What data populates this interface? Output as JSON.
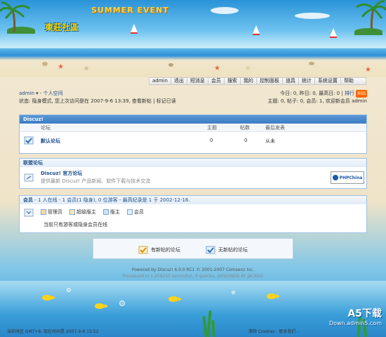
{
  "header": {
    "banner_title": "SUMMER EVENT",
    "logo_text": "東莊社區"
  },
  "nav": {
    "items": [
      "admin",
      "退出",
      "短消息",
      "会员",
      "搜索",
      "我的",
      "控制面板",
      "道具",
      "统计",
      "系统设置",
      "帮助"
    ]
  },
  "userbar": {
    "user": "admin",
    "space_link": "- 个人空间",
    "status_line": "状态: 隐身模式, 您上次访问是在 2007-9-6 13:39, 查看新帖 | 标记已读",
    "stats_line": "今日: 0, 昨日: 0, 最高日: 0 |",
    "stats_link": "排行",
    "rss": "RSS",
    "summary_line": "主题: 0, 帖子: 0, 会员: 1, 欢迎新会员 admin"
  },
  "forum_panel": {
    "title": "Discuz!",
    "columns": [
      "论坛",
      "主题",
      "帖数",
      "最后发表"
    ],
    "rows": [
      {
        "name": "默认论坛",
        "topics": "0",
        "posts": "0",
        "last": "从未"
      }
    ]
  },
  "union_panel": {
    "title": "联盟论坛",
    "name": "Discuz! 官方论坛",
    "desc": "提供最新 Discuz! 产品新闻、软件下载与技术交流",
    "logo": "PHPChina"
  },
  "online_panel": {
    "title": "会员",
    "summary": " - 1 人在线 - 1 会员(1 隐身), 0 位游客 - 最高纪录是 1 于 2002-12-16.",
    "roles": [
      "管理员",
      "超级版主",
      "版主",
      "会员"
    ],
    "note": "当前只有游客或隐身会员在线"
  },
  "legend": {
    "new_posts": "有新帖的论坛",
    "no_new_posts": "无新帖的论坛"
  },
  "footer": {
    "line1": "Powered by Discuz! 6.0.0 RC1 © 2001-2007 Comsenz Inc.",
    "line2": "Processed in 1.209255 second(s), 4 queries. DESIGNED BY JACKOO",
    "time_line": "当前时区 GMT+8, 现在时间是 2007-9-8 13:52",
    "clear_cookies": "清除 Cookies - 联系我们 -",
    "watermark_top": "A5下载",
    "watermark_bottom": "Down.admin5.com"
  },
  "colors": {
    "panel_head": "#3b7dc4",
    "link": "#1a4d8f",
    "sand": "#efe3c8",
    "sea": "#2f8fd6"
  }
}
